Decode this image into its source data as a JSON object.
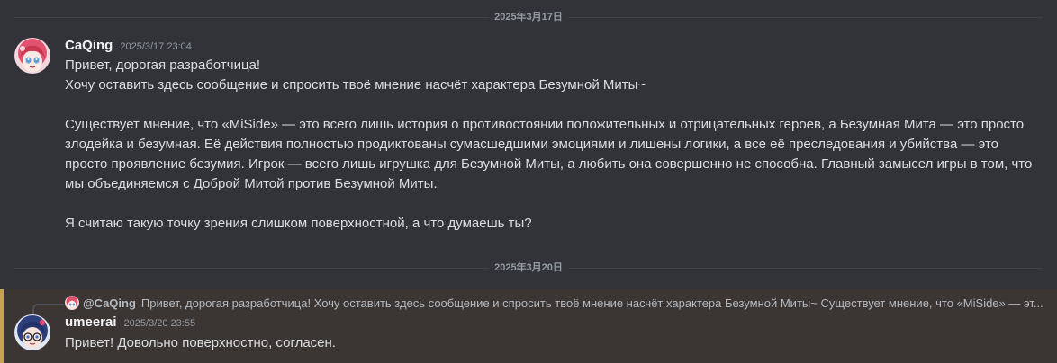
{
  "dates": {
    "first": "2025年3月17日",
    "second": "2025年3月20日"
  },
  "message1": {
    "username": "CaQing",
    "timestamp": "2025/3/17 23:04",
    "paragraphs": [
      "Привет, дорогая разработчица!",
      "Хочу оставить здесь сообщение и спросить твоё мнение насчёт характера Безумной Миты~",
      "Существует мнение, что «MiSide» — это всего лишь история о противостоянии положительных и отрицательных героев, а Безумная Мита — это просто злодейка и безумная. Её действия полностью продиктованы сумасшедшими эмоциями и лишены логики, а все её преследования и убийства — это просто проявление безумия. Игрок — всего лишь игрушка для Безумной Миты, а любить она совершенно не способна. Главный замысел игры в том, что мы объединяемся с Доброй Митой против Безумной Миты.",
      "Я считаю такую точку зрения слишком поверхностной, а что думаешь ты?"
    ]
  },
  "message2": {
    "reply": {
      "user": "@CaQing",
      "text": "Привет, дорогая разработчица! Хочу оставить здесь сообщение и спросить твоё мнение насчёт характера Безумной Миты~  Существует мнение, что «MiSide» — эт..."
    },
    "username": "umeerai",
    "timestamp": "2025/3/20 23:55",
    "text": "Привет! Довольно поверхностно, согласен."
  },
  "colors": {
    "background": "#313338",
    "highlight": "#3b3634",
    "highlight_bar": "#c6a352"
  }
}
